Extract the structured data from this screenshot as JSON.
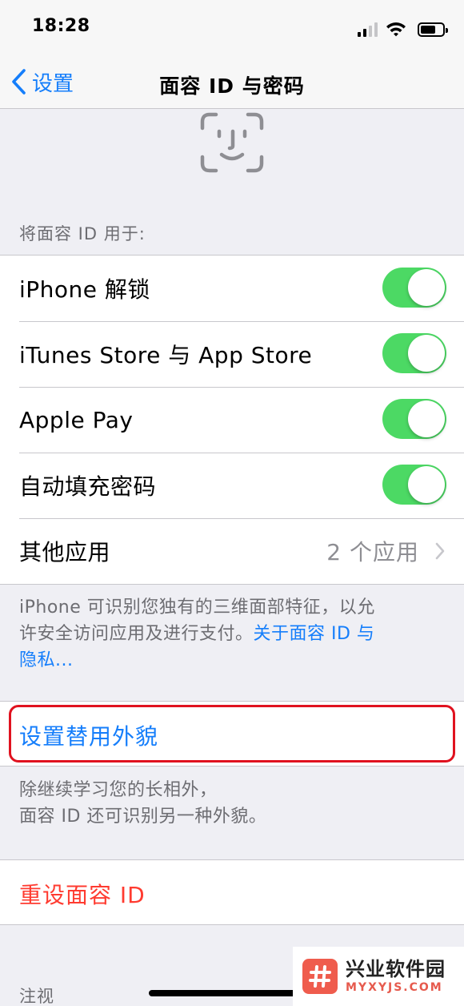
{
  "status_bar": {
    "time": "18:28"
  },
  "nav": {
    "back_label": "设置",
    "title": "面容 ID 与密码"
  },
  "use_for": {
    "header": "将面容 ID 用于:",
    "items": [
      {
        "label": "iPhone 解锁",
        "enabled": true
      },
      {
        "label": "iTunes Store 与 App Store",
        "enabled": true
      },
      {
        "label": "Apple Pay",
        "enabled": true
      },
      {
        "label": "自动填充密码",
        "enabled": true
      }
    ],
    "other_apps": {
      "label": "其他应用",
      "detail": "2 个应用"
    },
    "footer_line1": "iPhone 可识别您独有的三维面部特征，以允",
    "footer_line2": "许安全访问应用及进行支付。",
    "footer_link_a": "关于面容 ID 与",
    "footer_link_b": "隐私..."
  },
  "alternate": {
    "label": "设置替用外貌",
    "footer_line1": "除继续学习您的长相外，",
    "footer_line2": "面容 ID 还可识别另一种外貌。"
  },
  "reset": {
    "label": "重设面容 ID"
  },
  "attention": {
    "header": "注视"
  },
  "watermark": {
    "name": "兴业软件园",
    "url": "MYXYJS.COM"
  },
  "colors": {
    "accent": "#157efb",
    "toggle_on": "#4cd964",
    "destructive": "#ff3b30",
    "highlight": "#e0121f"
  },
  "icons": {
    "back": "chevron-left-icon",
    "face": "face-id-icon",
    "disclosure": "chevron-right-icon"
  }
}
